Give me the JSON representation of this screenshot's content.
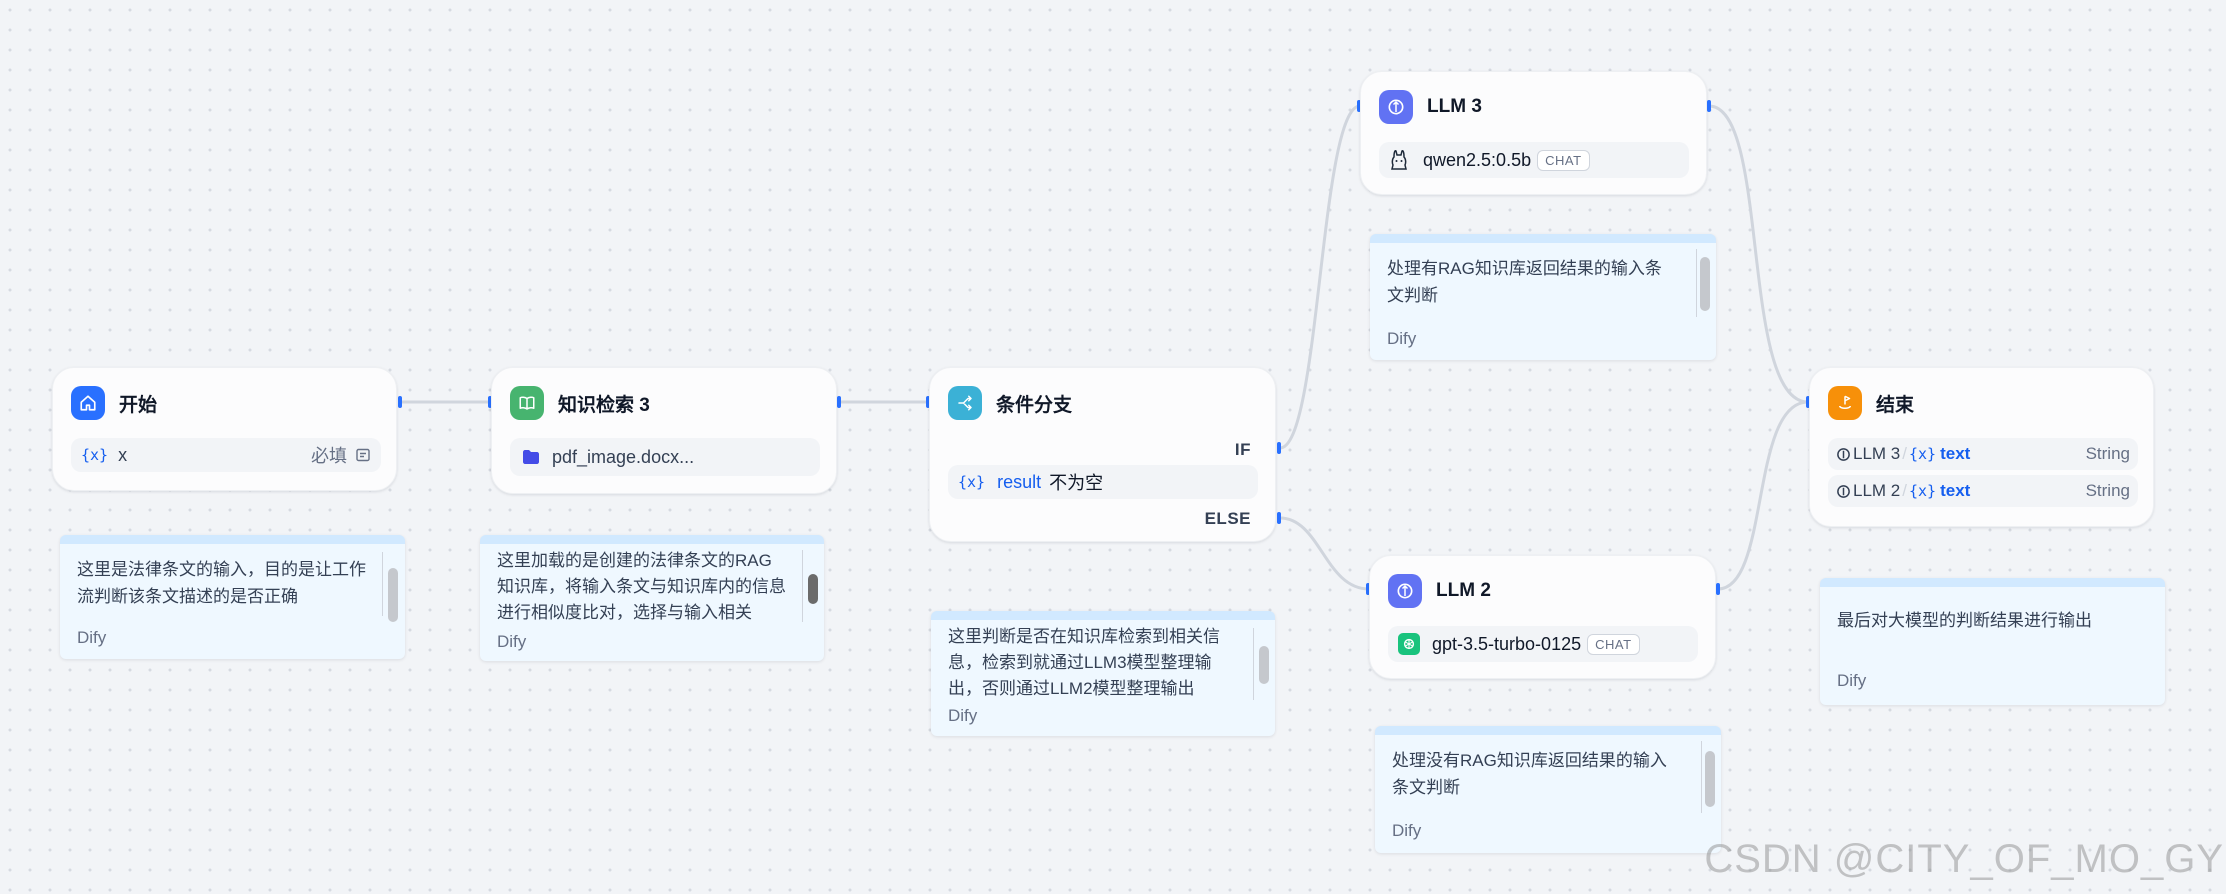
{
  "nodes": {
    "start": {
      "title": "开始",
      "var_icon": "{x}",
      "var_name": "x",
      "required": "必填"
    },
    "retrieval": {
      "title": "知识检索 3",
      "file": "pdf_image.docx..."
    },
    "ifelse": {
      "title": "条件分支",
      "if_label": "IF",
      "var_icon": "{x}",
      "var_name": "result",
      "operator": "不为空",
      "else_label": "ELSE"
    },
    "llm3": {
      "title": "LLM 3",
      "model": "qwen2.5:0.5b",
      "mode": "CHAT"
    },
    "llm2": {
      "title": "LLM 2",
      "model": "gpt-3.5-turbo-0125",
      "mode": "CHAT"
    },
    "end": {
      "title": "结束",
      "outputs": [
        {
          "source": "LLM 3",
          "var": "text",
          "type": "String"
        },
        {
          "source": "LLM 2",
          "var": "text",
          "type": "String"
        }
      ]
    }
  },
  "notes": {
    "start": {
      "text": "这里是法律条文的输入，目的是让工作流判断该条文描述的是否正确",
      "author": "Dify"
    },
    "retrieval": {
      "text": "这里加载的是创建的法律条文的RAG知识库，将输入条文与知识库内的信息进行相似度比对，选择与输入相关",
      "author": "Dify"
    },
    "ifelse": {
      "text": "这里判断是否在知识库检索到相关信息，检索到就通过LLM3模型整理输出，否则通过LLM2模型整理输出",
      "author": "Dify"
    },
    "llm3": {
      "text": "处理有RAG知识库返回结果的输入条文判断",
      "author": "Dify"
    },
    "llm2": {
      "text": "处理没有RAG知识库返回结果的输入条文判断",
      "author": "Dify"
    },
    "end": {
      "text": "最后对大模型的判断结果进行输出",
      "author": "Dify"
    }
  },
  "watermark": "CSDN @CITY_OF_MO_GY",
  "colors": {
    "start": "#2970ff",
    "retrieval": "#47b46f",
    "ifelse": "#3bb1d6",
    "llm": "#6172f3",
    "end": "#f79009",
    "edge": "#d0d5dd",
    "handle": "#2970ff"
  }
}
